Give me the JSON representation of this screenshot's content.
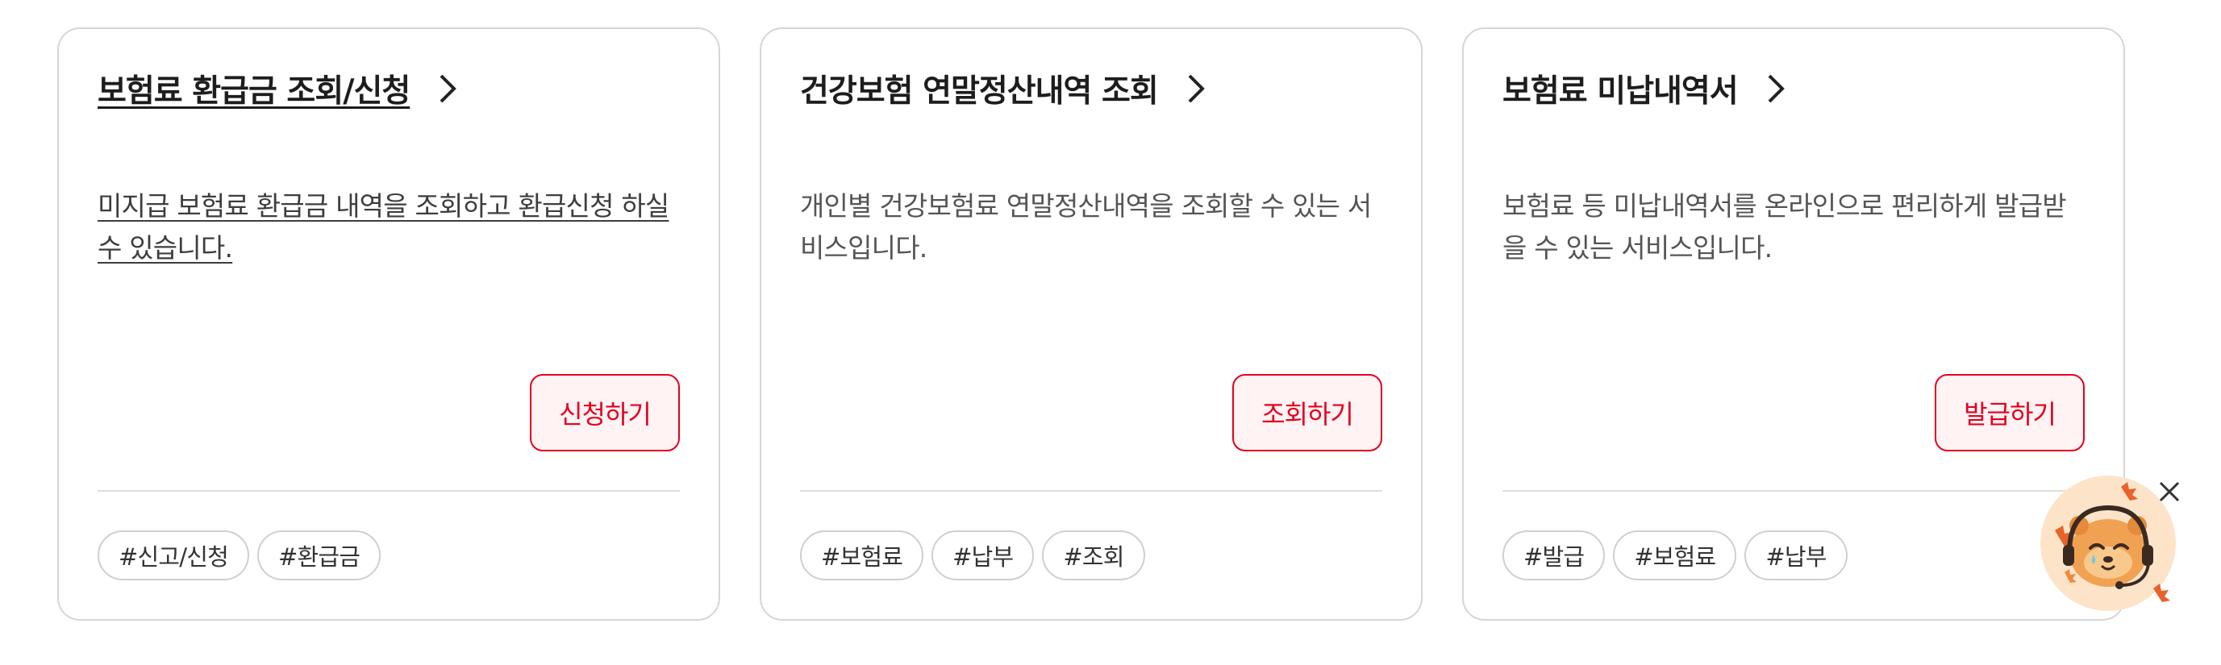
{
  "cards": [
    {
      "title": "보험료 환급금 조회/신청",
      "description": "미지급 보험료 환급금 내역을 조회하고 환급신청 하실 수 있습니다.",
      "button": "신청하기",
      "tags": [
        "#신고/신청",
        "#환급금"
      ]
    },
    {
      "title": "건강보험 연말정산내역 조회",
      "description": "개인별 건강보험료 연말정산내역을 조회할 수 있는 서비스입니다.",
      "button": "조회하기",
      "tags": [
        "#보험료",
        "#납부",
        "#조회"
      ]
    },
    {
      "title": "보험료 미납내역서",
      "description": "보험료 등 미납내역서를 온라인으로 편리하게 발급받을 수 있는 서비스입니다.",
      "button": "발급하기",
      "tags": [
        "#발급",
        "#보험료",
        "#납부"
      ]
    }
  ],
  "icons": {
    "chevron": "chevron-right-icon",
    "close": "close-icon",
    "mascot": "chatbot-mascot-icon"
  },
  "colors": {
    "accent": "#e5001e",
    "button_bg": "#fff3f4",
    "border": "#d6d6d6",
    "mascot_bg": "#fde4c9"
  }
}
